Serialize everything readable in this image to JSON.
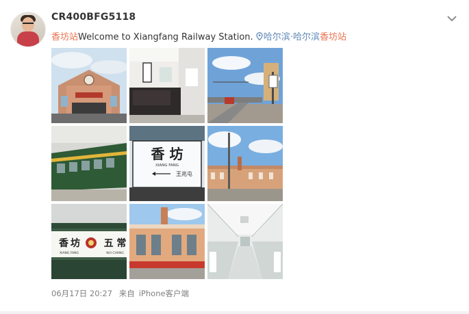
{
  "post": {
    "username": "CR400BFG5118",
    "text_highlight": "香坊站",
    "text_body": "Welcome to Xiangfang Railway Station.",
    "location_a": "哈尔滨",
    "location_sep": "·",
    "location_b_blue": "哈尔滨",
    "location_b_red": "香坊站",
    "timestamp": "06月17日 20:27",
    "source_prefix": "来自",
    "source_device": "iPhone客户端"
  },
  "photos": {
    "sign_large_chars": "香 坊",
    "sign_pinyin": "XIANG FANG",
    "sign_next_station": "王兆屯",
    "plaque_chars_left": "香",
    "plaque_chars_mid": "坊",
    "plaque_chars_right": "五 常",
    "plaque_pinyin_left": "XIANG FANG",
    "plaque_pinyin_right": "WU CHANG"
  },
  "colors": {
    "accent_red": "#eb7350",
    "link_blue": "#5f89b8",
    "train_green": "#2e5a36"
  }
}
